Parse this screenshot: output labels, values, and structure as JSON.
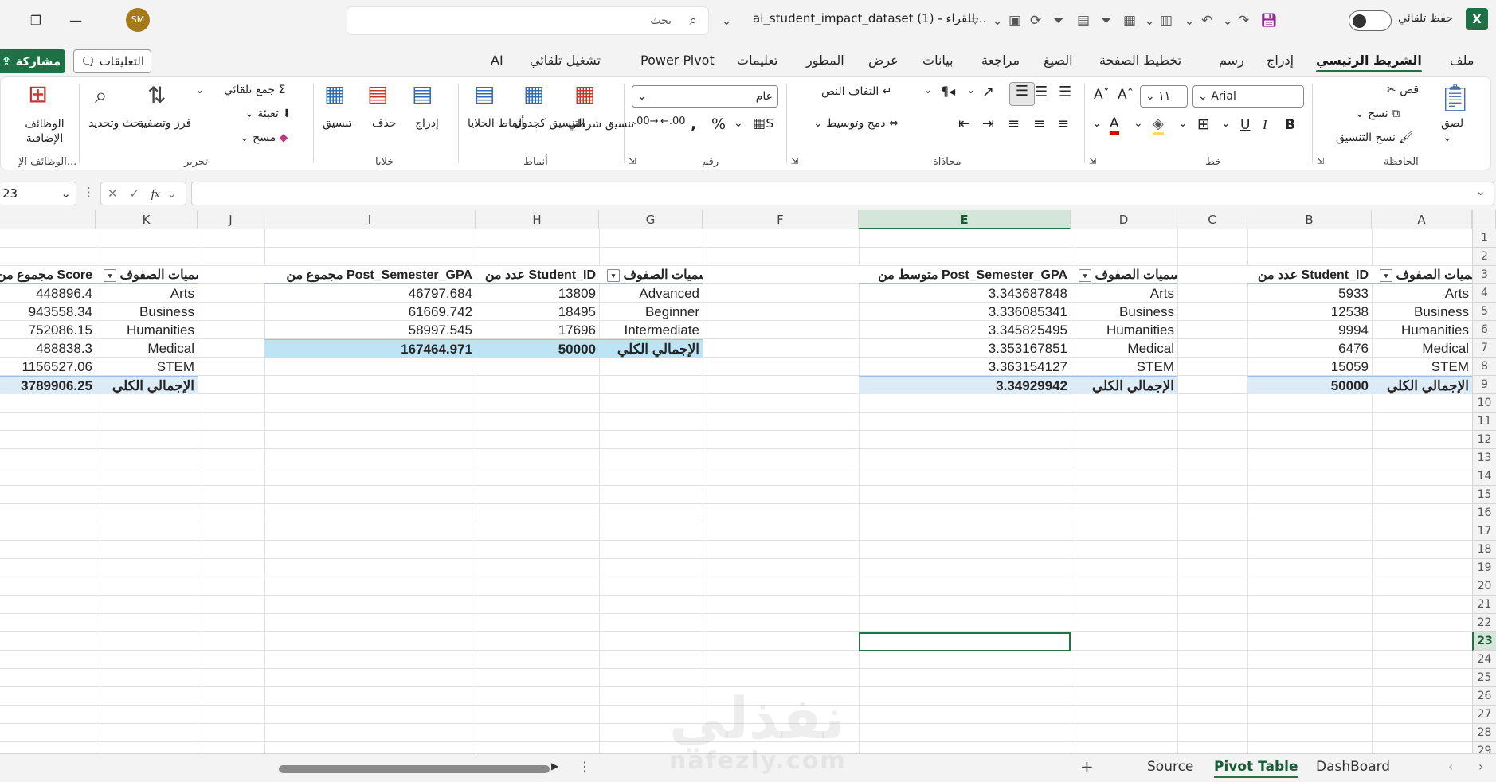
{
  "titlebar": {
    "avatar_initials": "SM",
    "search_placeholder": "بحث",
    "file_title": "ai_student_impact_dataset (1)  -  للقراء...",
    "autosave_label": "حفظ تلقائي"
  },
  "tabs": [
    {
      "label": "ملف"
    },
    {
      "label": "الشريط الرئيسي",
      "active": true
    },
    {
      "label": "إدراج"
    },
    {
      "label": "رسم"
    },
    {
      "label": "تخطيط الصفحة"
    },
    {
      "label": "الصيغ"
    },
    {
      "label": "مراجعة"
    },
    {
      "label": "بيانات"
    },
    {
      "label": "عرض"
    },
    {
      "label": "المطور"
    },
    {
      "label": "تعليمات"
    },
    {
      "label": "Power Pivot"
    },
    {
      "label": "تشغيل تلقائي"
    },
    {
      "label": "AI"
    }
  ],
  "buttons": {
    "comments": "التعليقات",
    "share": "مشاركة"
  },
  "ribbon": {
    "clipboard": {
      "paste": "لصق",
      "cut": "قص",
      "copy": "نسخ",
      "format_painter": "نسخ التنسيق",
      "group": "الحافظة"
    },
    "font": {
      "name": "Arial",
      "size": "١١",
      "group": "خط"
    },
    "alignment": {
      "wrap": "التفاف النص",
      "merge": "دمج وتوسيط",
      "group": "محاذاة"
    },
    "number": {
      "format": "عام",
      "group": "رقم"
    },
    "styles": {
      "conditional": "تنسيق شرطي",
      "table": "التنسيق كجدول",
      "cell_styles": "أنماط الخلايا",
      "group": "أنماط"
    },
    "cells": {
      "insert": "إدراج",
      "delete": "حذف",
      "format": "تنسيق",
      "group": "خلايا"
    },
    "editing": {
      "autosum": "جمع تلقائي",
      "fill": "تعبئة",
      "clear": "مسح",
      "sort": "فرز وتصفية",
      "find": "بحث وتحديد",
      "group": "تحرير"
    },
    "addins": {
      "label": "الوظائف الإضافية",
      "group": "الوظائف الإ..."
    }
  },
  "formula_bar": {
    "name_box": "23",
    "fx": "fx"
  },
  "columns": [
    "A",
    "B",
    "C",
    "D",
    "E",
    "F",
    "G",
    "H",
    "I",
    "J",
    "K"
  ],
  "rows": [
    "1",
    "2",
    "3",
    "4",
    "5",
    "6",
    "7",
    "8",
    "9",
    "10",
    "11",
    "12",
    "13",
    "14",
    "15",
    "16",
    "17",
    "18",
    "19",
    "20",
    "21",
    "22",
    "23",
    "24",
    "25",
    "26",
    "27",
    "28",
    "29"
  ],
  "pivot1": {
    "row_label": "تسميات الصفوف",
    "value_label": "عدد من Student_ID",
    "rows": [
      {
        "label": "Arts",
        "value": "5933"
      },
      {
        "label": "Business",
        "value": "12538"
      },
      {
        "label": "Humanities",
        "value": "9994"
      },
      {
        "label": "Medical",
        "value": "6476"
      },
      {
        "label": "STEM",
        "value": "15059"
      }
    ],
    "total_label": "الإجمالي الكلي",
    "total_value": "50000"
  },
  "pivot2": {
    "row_label": "تسميات الصفوف",
    "value_label": "متوسط من Post_Semester_GPA",
    "rows": [
      {
        "label": "Arts",
        "value": "3.343687848"
      },
      {
        "label": "Business",
        "value": "3.336085341"
      },
      {
        "label": "Humanities",
        "value": "3.345825495"
      },
      {
        "label": "Medical",
        "value": "3.353167851"
      },
      {
        "label": "STEM",
        "value": "3.363154127"
      }
    ],
    "total_label": "الإجمالي الكلي",
    "total_value": "3.34929942"
  },
  "pivot3": {
    "row_label": "تسميات الصفوف",
    "count_label": "عدد من Student_ID",
    "sum_label": "مجموع من Post_Semester_GPA",
    "rows": [
      {
        "label": "Advanced",
        "count": "13809",
        "sum": "46797.684"
      },
      {
        "label": "Beginner",
        "count": "18495",
        "sum": "61669.742"
      },
      {
        "label": "Intermediate",
        "count": "17696",
        "sum": "58997.545"
      }
    ],
    "total_label": "الإجمالي الكلي",
    "total_count": "50000",
    "total_sum": "167464.971"
  },
  "pivot4": {
    "row_label": "تسميات الصفوف",
    "value_label": "مجموع من Score",
    "rows": [
      {
        "label": "Arts",
        "value": "448896.4"
      },
      {
        "label": "Business",
        "value": "943558.34"
      },
      {
        "label": "Humanities",
        "value": "752086.15"
      },
      {
        "label": "Medical",
        "value": "488838.3"
      },
      {
        "label": "STEM",
        "value": "1156527.06"
      }
    ],
    "total_label": "الإجمالي الكلي",
    "total_value": "3789906.25"
  },
  "sheets": [
    {
      "label": "DashBoard"
    },
    {
      "label": "Pivot Table",
      "active": true
    },
    {
      "label": "Source"
    }
  ],
  "watermark": {
    "arabic": "نفذلي",
    "latin": "nafezly.com"
  },
  "colors": {
    "accent": "#217346",
    "pivot_total": "#ddebf7",
    "pivot_border": "#9bc2e6"
  }
}
